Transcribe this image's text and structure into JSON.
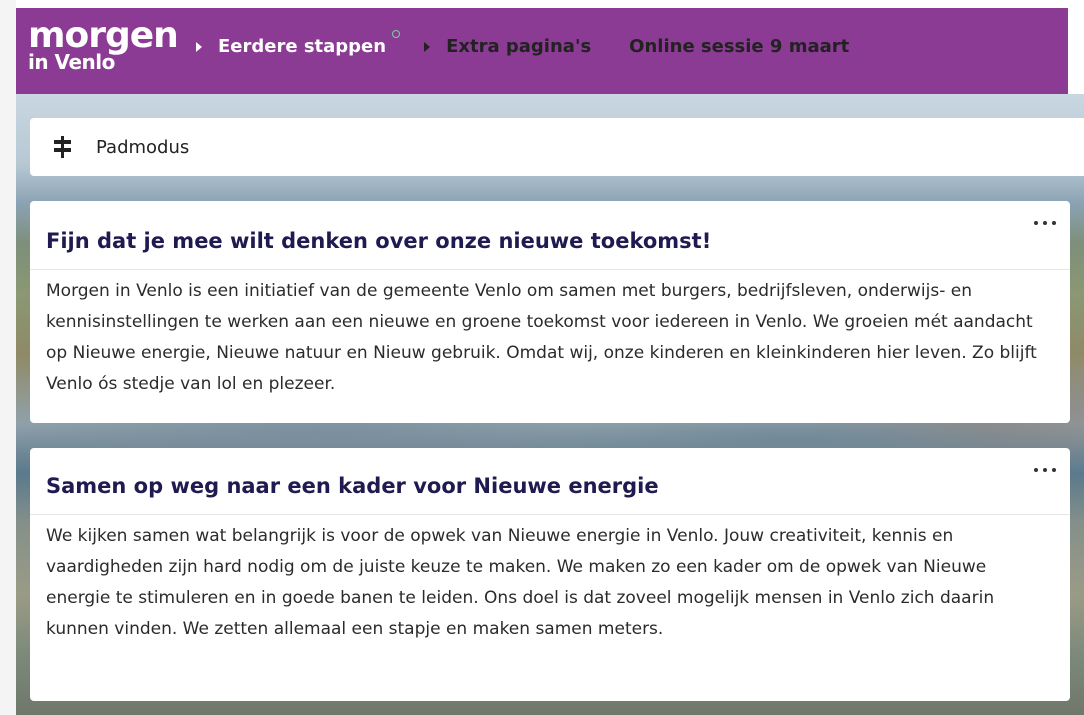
{
  "header": {
    "logo_top": "morgen",
    "logo_bottom": "in Venlo",
    "nav": [
      {
        "label": "Eerdere stappen"
      },
      {
        "label": "Extra pagina's"
      },
      {
        "label": "Online sessie 9 maart"
      }
    ]
  },
  "padmodus": {
    "label": "Padmodus"
  },
  "cards": [
    {
      "title": "Fijn dat je mee wilt denken over onze nieuwe toekomst!",
      "body": "Morgen in Venlo is een initiatief van de gemeente Venlo om samen met burgers, bedrijfsleven, onderwijs- en kennisinstellingen te werken aan een nieuwe en groene toekomst voor iedereen in Venlo. We groeien mét aandacht op Nieuwe energie, Nieuwe natuur en Nieuw gebruik. Omdat wij, onze kinderen en kleinkinderen hier leven. Zo blijft Venlo ós stedje van lol en plezeer."
    },
    {
      "title": "Samen op weg naar een kader voor Nieuwe energie",
      "body": "We kijken samen wat belangrijk is voor de opwek van Nieuwe energie in Venlo. Jouw creativiteit, kennis en vaardigheden zijn hard nodig om de juiste keuze te maken. We maken zo een kader om de opwek van Nieuwe energie te stimuleren en in goede banen te leiden. Ons doel is dat zoveel mogelijk mensen in Venlo zich daarin kunnen vinden. We zetten allemaal een stapje en maken samen meters."
    }
  ],
  "colors": {
    "brand": "#8b3b93",
    "title": "#1f1a4f"
  },
  "icons": {
    "pad": "signpost-icon",
    "more": "more-horizontal-icon",
    "nav": "caret-right-icon"
  }
}
